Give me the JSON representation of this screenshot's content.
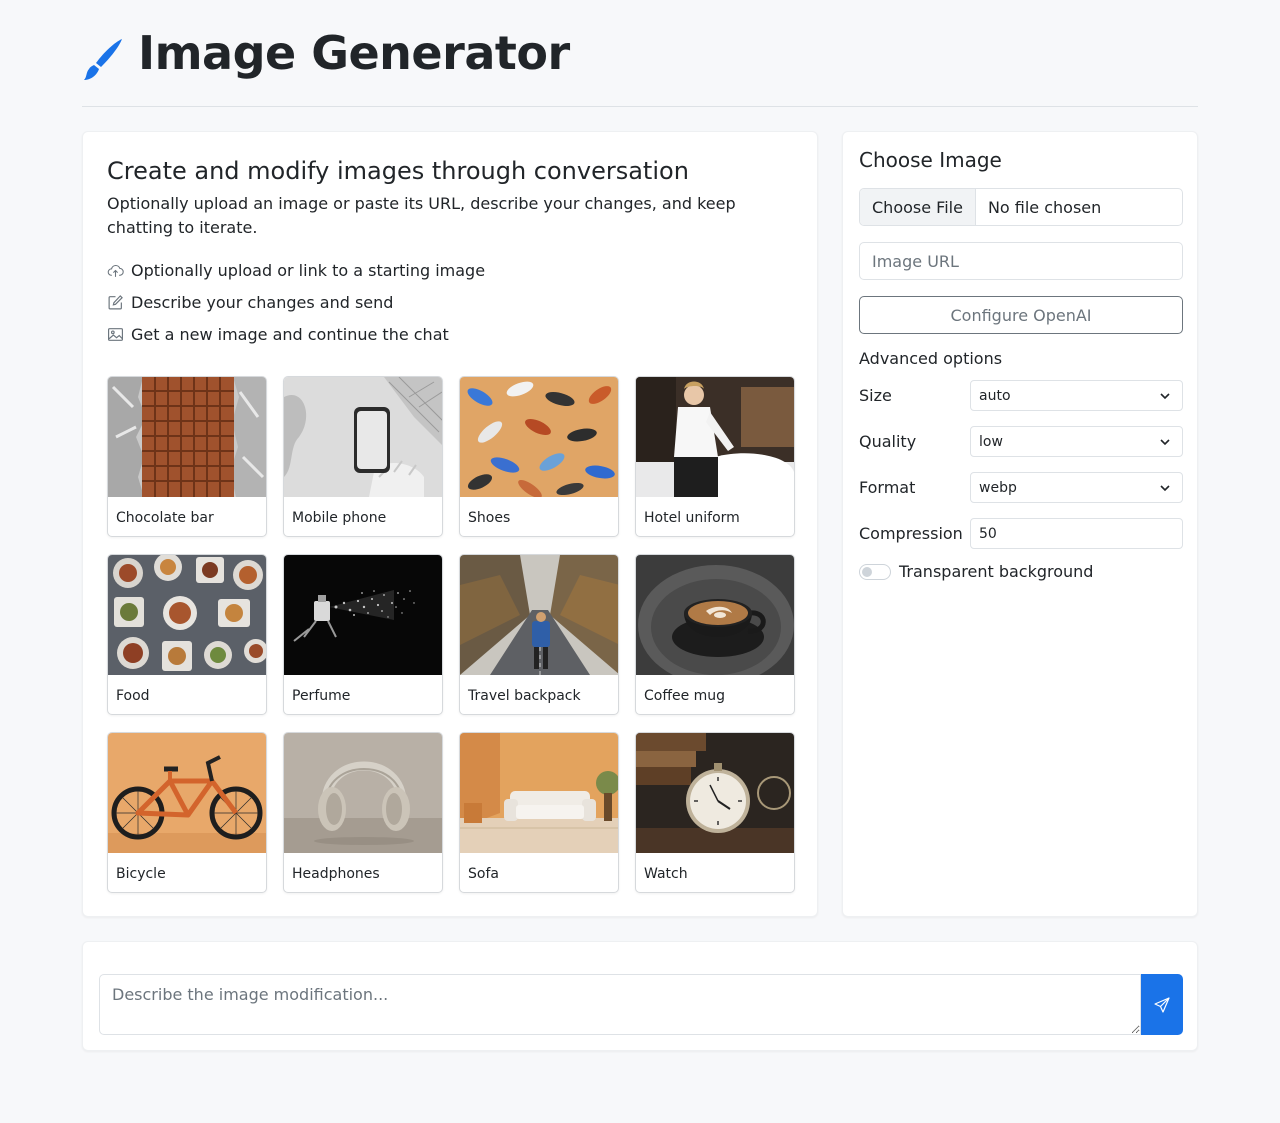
{
  "app": {
    "title": "Image Generator"
  },
  "intro": {
    "heading": "Create and modify images through conversation",
    "description": "Optionally upload an image or paste its URL, describe your changes, and keep chatting to iterate.",
    "steps": [
      {
        "icon": "cloud-upload-icon",
        "text": "Optionally upload or link to a starting image"
      },
      {
        "icon": "pencil-square-icon",
        "text": "Describe your changes and send"
      },
      {
        "icon": "image-icon",
        "text": "Get a new image and continue the chat"
      }
    ]
  },
  "examples": [
    {
      "label": "Chocolate bar"
    },
    {
      "label": "Mobile phone"
    },
    {
      "label": "Shoes"
    },
    {
      "label": "Hotel uniform"
    },
    {
      "label": "Food"
    },
    {
      "label": "Perfume"
    },
    {
      "label": "Travel backpack"
    },
    {
      "label": "Coffee mug"
    },
    {
      "label": "Bicycle"
    },
    {
      "label": "Headphones"
    },
    {
      "label": "Sofa"
    },
    {
      "label": "Watch"
    }
  ],
  "sidebar": {
    "title": "Choose Image",
    "file_button": "Choose File",
    "file_status": "No file chosen",
    "url_placeholder": "Image URL",
    "config_button": "Configure OpenAI",
    "advanced_label": "Advanced options",
    "options": {
      "size": {
        "label": "Size",
        "value": "auto"
      },
      "quality": {
        "label": "Quality",
        "value": "low"
      },
      "format": {
        "label": "Format",
        "value": "webp"
      },
      "compression": {
        "label": "Compression",
        "value": "50"
      }
    },
    "transparent_label": "Transparent background",
    "transparent_on": false
  },
  "composer": {
    "placeholder": "Describe the image modification..."
  },
  "colors": {
    "accent": "#1a73e8",
    "background": "#f7f8fa"
  }
}
